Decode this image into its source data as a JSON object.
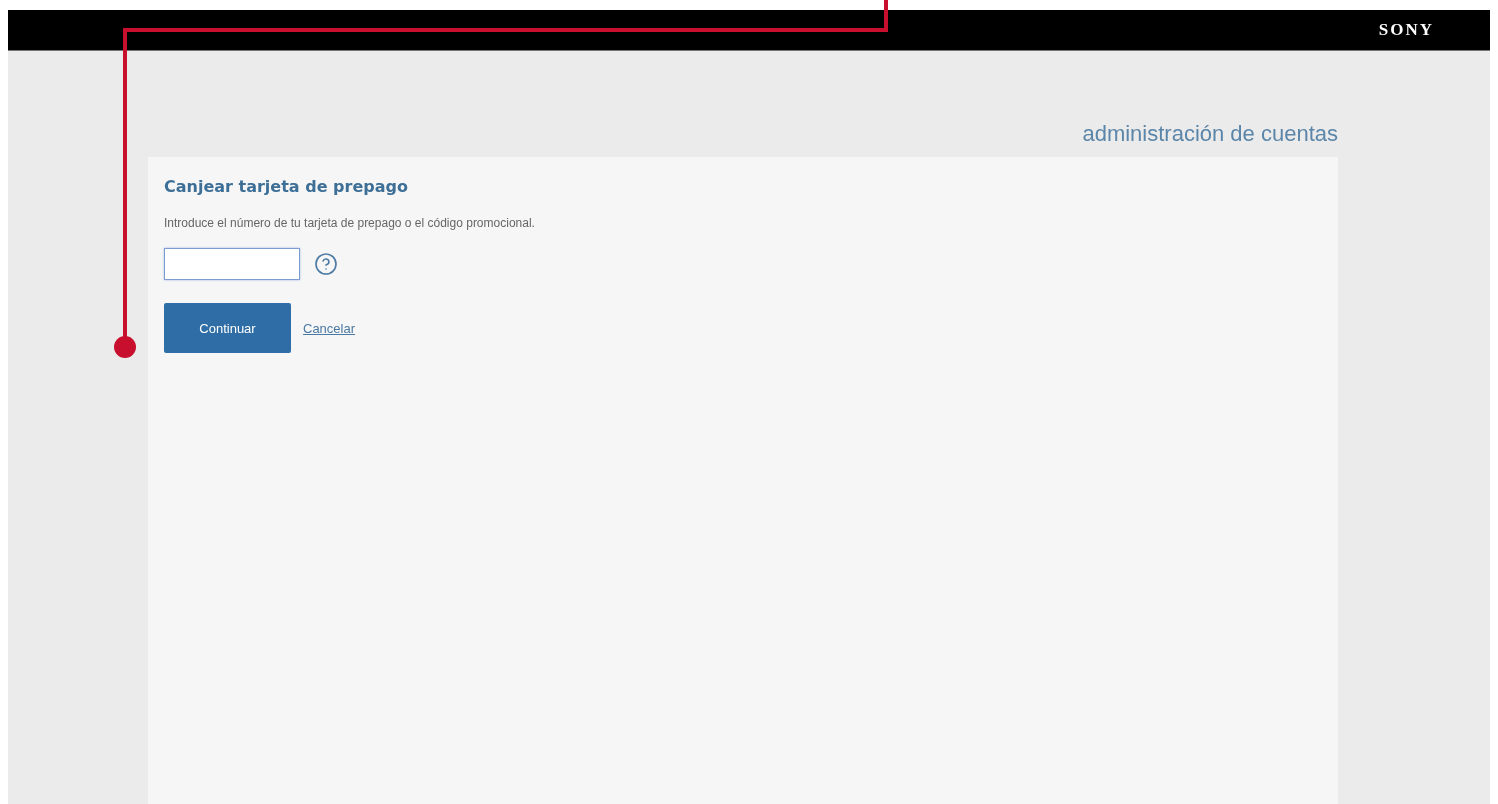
{
  "header": {
    "logo": "SONY"
  },
  "section_title": "administración de cuentas",
  "card": {
    "title": "Canjear tarjeta de prepago",
    "instructions": "Introduce el número de tu tarjeta de prepago o el código promocional.",
    "code_field": {
      "focused": true
    },
    "buttons": [
      {
        "kind": "primary",
        "label": "Continuar"
      },
      {
        "kind": "link",
        "label": "Cancelar"
      }
    ]
  }
}
